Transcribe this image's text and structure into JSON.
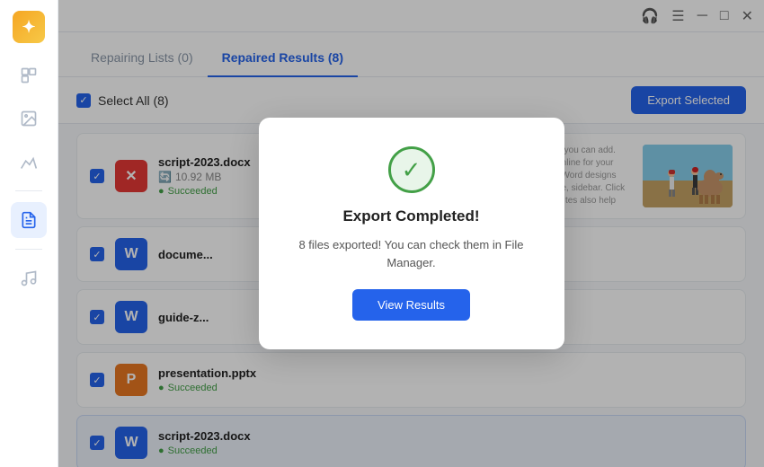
{
  "titlebar": {
    "icons": [
      "headphones",
      "menu",
      "minimize",
      "maximize",
      "close"
    ]
  },
  "tabs": [
    {
      "label": "Repairing Lists (0)",
      "active": false
    },
    {
      "label": "Repaired Results (8)",
      "active": true
    }
  ],
  "toolbar": {
    "select_all_label": "Select All (8)",
    "export_button_label": "Export Selected"
  },
  "files": [
    {
      "name": "script-2023.docx",
      "size": "10.92 MB",
      "status": "Succeeded",
      "icon_type": "red",
      "icon_letter": "X",
      "has_preview": true,
      "preview_type": "camel"
    },
    {
      "name": "docume...",
      "size": "",
      "status": "",
      "icon_type": "blue",
      "icon_letter": "W",
      "has_preview": true,
      "preview_type": "text"
    },
    {
      "name": "guide-z...",
      "size": "",
      "status": "",
      "icon_type": "blue",
      "icon_letter": "W",
      "has_preview": false,
      "preview_type": "none"
    },
    {
      "name": "presentation.pptx",
      "size": "",
      "status": "Succeeded",
      "icon_type": "orange",
      "icon_letter": "P",
      "has_preview": false,
      "preview_type": "none"
    },
    {
      "name": "script-2023.docx",
      "size": "",
      "status": "Succeeded",
      "icon_type": "blue",
      "icon_letter": "W",
      "has_preview": false,
      "preview_type": "none"
    }
  ],
  "text_preview_content": "your point. When you click Online Video, you can add. You can also type a keyword to search online for your document look professionally produced. Word designs that complement each other. For example, sidebar. Click Insert and then choose the elements you tes also help keep your document coordinated. When tures, charts, and SmartArt graphics change to match ndings change to match the new theme. Save time in head them.",
  "modal": {
    "title": "Export Completed!",
    "message": "8 files exported! You can check them in File Manager.",
    "button_label": "View Results",
    "icon": "✓"
  }
}
